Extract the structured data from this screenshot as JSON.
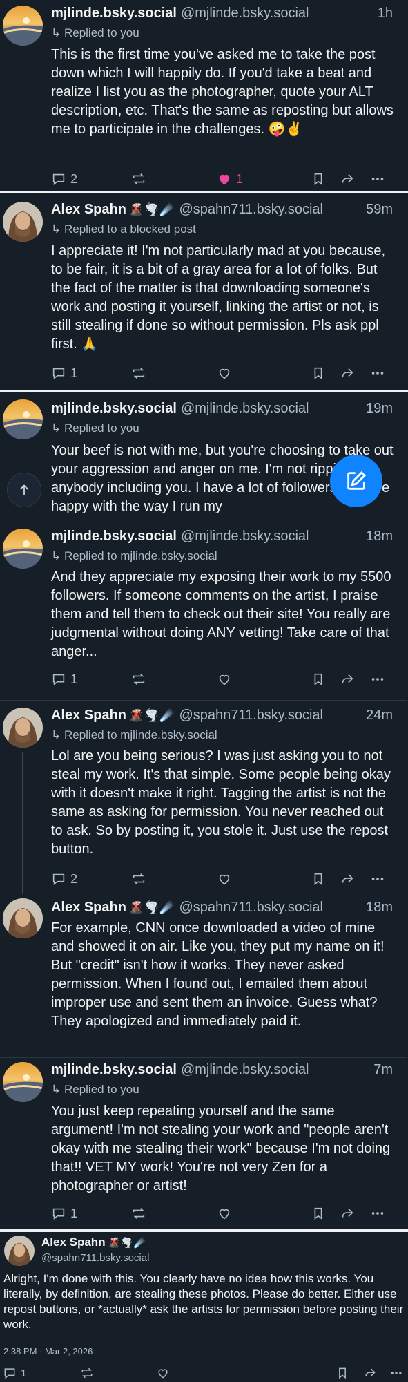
{
  "posts": [
    {
      "author": "mjlinde.bsky.social",
      "emoji": "",
      "handle": "@mjlinde.bsky.social",
      "time": "1h",
      "reply": "↳ Replied to you",
      "text": "This is the first time you've asked me to take the post down which I will happily do. If you'd take a beat and realize I list you as the photographer, quote your ALT description, etc. That's the same as reposting but allows me to participate in the challenges. 🤪✌️",
      "replies": "2",
      "reposts": "",
      "likes": "1",
      "liked": true
    },
    {
      "author": "Alex Spahn",
      "emoji": "🌋🌪️☄️",
      "handle": "@spahn711.bsky.social",
      "time": "59m",
      "reply": "↳ Replied to a blocked post",
      "text": "I appreciate it! I'm not particularly mad at you because, to be fair, it is a bit of a gray area for a lot of folks. But the fact of the matter is that downloading someone's work and posting it yourself, linking the artist or not, is still stealing if done so without permission. Pls ask ppl first. 🙏",
      "replies": "1",
      "reposts": "",
      "likes": "",
      "liked": false
    },
    {
      "author": "mjlinde.bsky.social",
      "emoji": "",
      "handle": "@mjlinde.bsky.social",
      "time": "19m",
      "reply": "↳ Replied to you",
      "text": "Your beef is not with me, but you're choosing to take out your aggression and anger on me. I'm not ripping off anybody including you. I have a lot of followers who are happy with the way I run my",
      "replies": "",
      "reposts": "",
      "likes": "",
      "liked": false
    },
    {
      "author": "mjlinde.bsky.social",
      "emoji": "",
      "handle": "@mjlinde.bsky.social",
      "time": "18m",
      "reply": "↳ Replied to mjlinde.bsky.social",
      "text": "And they appreciate my exposing their work to my 5500 followers. If someone comments on the artist, I praise them and tell them to check out their site! You really are judgmental without doing ANY vetting! Take care of that anger...",
      "replies": "1",
      "reposts": "",
      "likes": "",
      "liked": false
    },
    {
      "author": "Alex Spahn",
      "emoji": "🌋🌪️☄️",
      "handle": "@spahn711.bsky.social",
      "time": "24m",
      "reply": "↳ Replied to mjlinde.bsky.social",
      "text": "Lol are you being serious? I was just asking you to not steal my work. It's that simple. Some people being okay with it doesn't make it right. Tagging the artist is not the same as asking for permission. You never reached out to ask. So by posting it, you stole it. Just use the repost button.",
      "replies": "2",
      "reposts": "",
      "likes": "",
      "liked": false
    },
    {
      "author": "Alex Spahn",
      "emoji": "🌋🌪️☄️",
      "handle": "@spahn711.bsky.social",
      "time": "18m",
      "reply": "",
      "text": "For example, CNN once downloaded a video of mine and showed it on air. Like you, they put my name on it! But \"credit\" isn't how it works. They never asked permission. When I found out, I emailed them about improper use and sent them an invoice. Guess what? They apologized and immediately paid it.",
      "replies": "",
      "reposts": "",
      "likes": "",
      "liked": false
    },
    {
      "author": "mjlinde.bsky.social",
      "emoji": "",
      "handle": "@mjlinde.bsky.social",
      "time": "7m",
      "reply": "↳ Replied to you",
      "text": "You just keep repeating yourself and the same argument! I'm not stealing your work and \"people aren't okay with me stealing their work\" because I'm not doing that!! VET MY work!  You're not very Zen for a photographer or artist!",
      "replies": "1",
      "reposts": "",
      "likes": "",
      "liked": false
    }
  ],
  "focus_post": {
    "author": "Alex Spahn",
    "emoji": "🌋🌪️☄️",
    "handle": "@spahn711.bsky.social",
    "text": "Alright, I'm done with this. You clearly have no idea how this works. You literally, by definition, are stealing these photos. Please do better. Either use repost buttons, or *actually* ask the artists for permission before posting their work.",
    "date": "2:38 PM · Mar 2, 2026",
    "replies": "1"
  },
  "icons": {
    "reply": "speech-bubble-icon",
    "repost": "repost-arrows-icon",
    "like": "heart-icon",
    "bookmark": "bookmark-icon",
    "share": "share-arrow-icon",
    "more": "ellipsis-icon",
    "compose": "pencil-square-icon",
    "scroll_top": "arrow-up-icon"
  },
  "colors": {
    "background": "#161e27",
    "text": "#f1f3f5",
    "muted": "#aebbc9",
    "like_active": "#ec4899",
    "accent": "#1083fe"
  }
}
